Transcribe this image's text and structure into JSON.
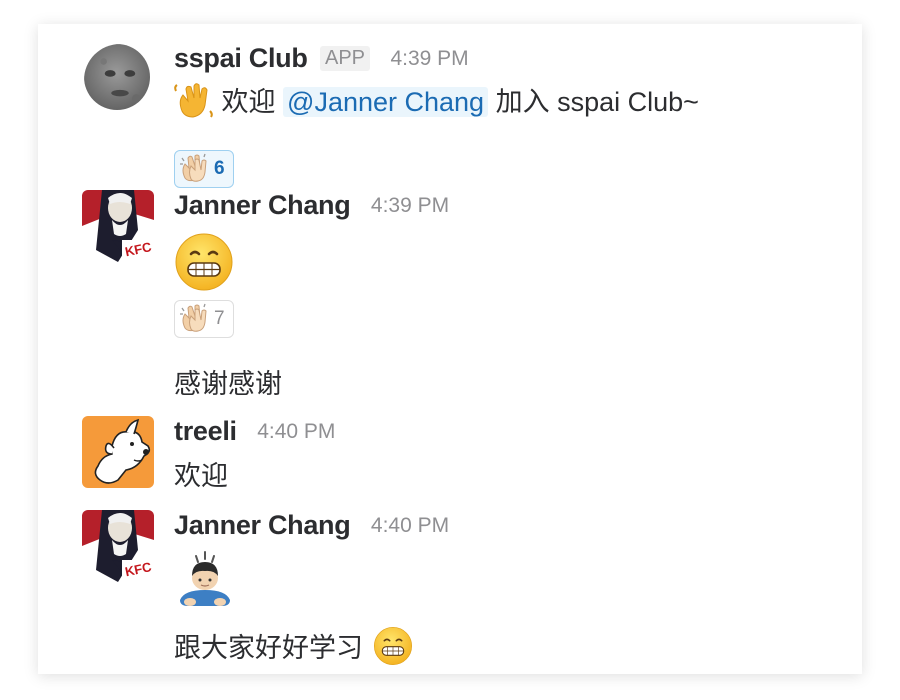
{
  "messages": [
    {
      "sender": "sspai Club",
      "badge": "APP",
      "time": "4:39 PM",
      "text_before": "欢迎",
      "mention": "@Janner Chang",
      "text_after": "加入 sspai Club~",
      "reaction": {
        "emoji": "clapping-hands",
        "count": "6",
        "active": true
      }
    },
    {
      "sender": "Janner Chang",
      "time": "4:39 PM",
      "emoji": "grinning-face",
      "reaction": {
        "emoji": "clapping-hands",
        "count": "7",
        "active": false
      },
      "followup_text": "感谢感谢"
    },
    {
      "sender": "treeli",
      "time": "4:40 PM",
      "text": "欢迎"
    },
    {
      "sender": "Janner Chang",
      "time": "4:40 PM",
      "emoji": "person-bowing",
      "followup_text": "跟大家好好学习"
    }
  ],
  "colors": {
    "mention_text": "#1b6bb3",
    "mention_bg": "#eaf5fc",
    "time": "#8f8f92",
    "text": "#2c2d30"
  }
}
